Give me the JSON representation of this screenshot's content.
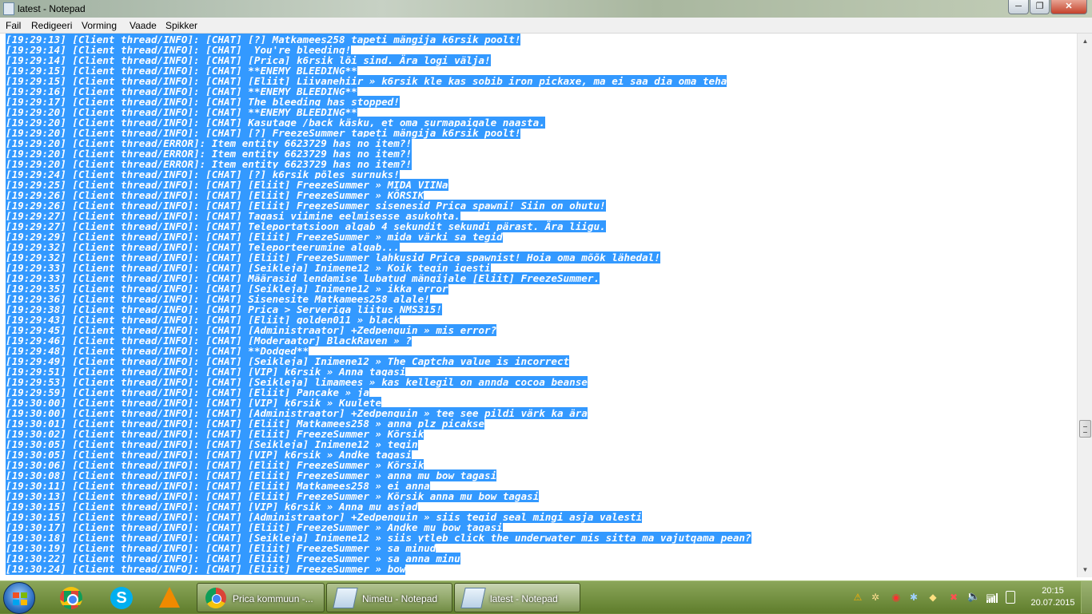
{
  "window": {
    "title": "latest - Notepad",
    "buttons": {
      "minimize": "─",
      "maximize": "❐",
      "close": "✕"
    }
  },
  "menu": [
    "Fail",
    "Redigeeri",
    "Vorming",
    "Vaade",
    "Spikker"
  ],
  "log_lines": [
    "[19:29:13] [Client thread/INFO]: [CHAT] [?] Matkamees258 tapeti mängija k6rsik poolt!",
    "[19:29:14] [Client thread/INFO]: [CHAT]  You're bleeding!",
    "[19:29:14] [Client thread/INFO]: [CHAT] [Prica] k6rsik lõi sind. Ära logi välja!",
    "[19:29:15] [Client thread/INFO]: [CHAT] **ENEMY BLEEDING**",
    "[19:29:15] [Client thread/INFO]: [CHAT] [Eliit] Liivanehiir » k6rsik kle kas sobib iron pickaxe, ma ei saa dia oma teha",
    "[19:29:16] [Client thread/INFO]: [CHAT] **ENEMY BLEEDING**",
    "[19:29:17] [Client thread/INFO]: [CHAT] The bleeding has stopped!",
    "[19:29:20] [Client thread/INFO]: [CHAT] **ENEMY BLEEDING**",
    "[19:29:20] [Client thread/INFO]: [CHAT] Kasutage /back käsku, et oma surmapaigale naasta.",
    "[19:29:20] [Client thread/INFO]: [CHAT] [?] FreezeSummer tapeti mängija k6rsik poolt!",
    "[19:29:20] [Client thread/ERROR]: Item entity 6623729 has no item?!",
    "[19:29:20] [Client thread/ERROR]: Item entity 6623729 has no item?!",
    "[19:29:20] [Client thread/ERROR]: Item entity 6623729 has no item?!",
    "[19:29:24] [Client thread/INFO]: [CHAT] [?] k6rsik põles surnuks!",
    "[19:29:25] [Client thread/INFO]: [CHAT] [Eliit] FreezeSummer » MIDA VIINa",
    "[19:29:26] [Client thread/INFO]: [CHAT] [Eliit] FreezeSummer » KÕRSIK",
    "[19:29:26] [Client thread/INFO]: [CHAT] [Eliit] FreezeSummer sisenesid Prica spawni! Siin on ohutu!",
    "[19:29:27] [Client thread/INFO]: [CHAT] Tagasi viimine eelmisesse asukohta.",
    "[19:29:27] [Client thread/INFO]: [CHAT] Teleportatsioon algab 4 sekundit sekundi pärast. Ära liigu.",
    "[19:29:29] [Client thread/INFO]: [CHAT] [Eliit] FreezeSummer » mida värki sa tegid",
    "[19:29:32] [Client thread/INFO]: [CHAT] Teleporteerumine algab...",
    "[19:29:32] [Client thread/INFO]: [CHAT] [Eliit] FreezeSummer lahkusid Prica spawnist! Hoia oma mõõk lähedal!",
    "[19:29:33] [Client thread/INFO]: [CHAT] [Seikleja] Inimene12 » Koik tegin igesti",
    "[19:29:33] [Client thread/INFO]: [CHAT] Määrasid lendamise lubatud mängijale [Eliit] FreezeSummer.",
    "[19:29:35] [Client thread/INFO]: [CHAT] [Seikleja] Inimene12 » ikka error",
    "[19:29:36] [Client thread/INFO]: [CHAT] Sisenesite Matkamees258 alale!",
    "[19:29:38] [Client thread/INFO]: [CHAT] Prica > Serveriga liitus NMS315!",
    "[19:29:43] [Client thread/INFO]: [CHAT] [Eliit] golden011 » black",
    "[19:29:45] [Client thread/INFO]: [CHAT] [Administraator] +Zedpenguin » mis error?",
    "[19:29:46] [Client thread/INFO]: [CHAT] [Moderaator] BlackRaven » ?",
    "[19:29:48] [Client thread/INFO]: [CHAT] **Dodged**",
    "[19:29:49] [Client thread/INFO]: [CHAT] [Seikleja] Inimene12 » The Captcha value is incorrect",
    "[19:29:51] [Client thread/INFO]: [CHAT] [VIP] k6rsik » Anna tagasi",
    "[19:29:53] [Client thread/INFO]: [CHAT] [Seikleja] limamees » kas kellegil on annda cocoa beanse",
    "[19:29:59] [Client thread/INFO]: [CHAT] [Eliit] Pancake » ja",
    "[19:30:00] [Client thread/INFO]: [CHAT] [VIP] k6rsik » Kuulete",
    "[19:30:00] [Client thread/INFO]: [CHAT] [Administraator] +Zedpenguin » tee see pildi värk ka ära",
    "[19:30:01] [Client thread/INFO]: [CHAT] [Eliit] Matkamees258 » anna plz picakse",
    "[19:30:02] [Client thread/INFO]: [CHAT] [Eliit] FreezeSummer » Kõrsik",
    "[19:30:05] [Client thread/INFO]: [CHAT] [Seikleja] Inimene12 » tegin",
    "[19:30:05] [Client thread/INFO]: [CHAT] [VIP] k6rsik » Andke tagasi",
    "[19:30:06] [Client thread/INFO]: [CHAT] [Eliit] FreezeSummer » Kõrsik",
    "[19:30:08] [Client thread/INFO]: [CHAT] [Eliit] FreezeSummer » anna mu bow tagasi",
    "[19:30:11] [Client thread/INFO]: [CHAT] [Eliit] Matkamees258 » ei anna",
    "[19:30:13] [Client thread/INFO]: [CHAT] [Eliit] FreezeSummer » Kõrsik anna mu bow tagasi",
    "[19:30:15] [Client thread/INFO]: [CHAT] [VIP] k6rsik » Anna mu asjad",
    "[19:30:15] [Client thread/INFO]: [CHAT] [Administraator] +Zedpenguin » siis tegid seal mingi asja valesti",
    "[19:30:17] [Client thread/INFO]: [CHAT] [Eliit] FreezeSummer » Andke mu bow tagasi",
    "[19:30:18] [Client thread/INFO]: [CHAT] [Seikleja] Inimene12 » siis ytleb click the underwater mis sitta ma vajutqama pean?",
    "[19:30:19] [Client thread/INFO]: [CHAT] [Eliit] FreezeSummer » sa minud",
    "[19:30:22] [Client thread/INFO]: [CHAT] [Eliit] FreezeSummer » sa anna minu",
    "[19:30:24] [Client thread/INFO]: [CHAT] [Eliit] FreezeSummer » bow"
  ],
  "taskbar": {
    "pinned": [
      {
        "name": "chrome",
        "icon": "chrome-icon"
      },
      {
        "name": "skype",
        "icon": "skype-icon",
        "glyph": "S"
      },
      {
        "name": "vlc",
        "icon": "vlc-icon"
      }
    ],
    "buttons": [
      {
        "label": "Prica kommuun -...",
        "icon": "chrome-icon"
      },
      {
        "label": "Nimetu - Notepad",
        "icon": "notepad-icon"
      },
      {
        "label": "latest - Notepad",
        "icon": "notepad-icon"
      }
    ],
    "tray_icons": [
      "warning-icon",
      "network-tools-icon",
      "antivirus-icon",
      "bluetooth-icon",
      "game-icon",
      "app-close-icon",
      "flag-icon",
      "printer-icon",
      "volume-icon",
      "signal-icon",
      "battery-icon"
    ],
    "time": "20:15",
    "date": "20.07.2015"
  },
  "colors": {
    "selection": "#3399ff",
    "taskbar": "#6f8f3e"
  }
}
